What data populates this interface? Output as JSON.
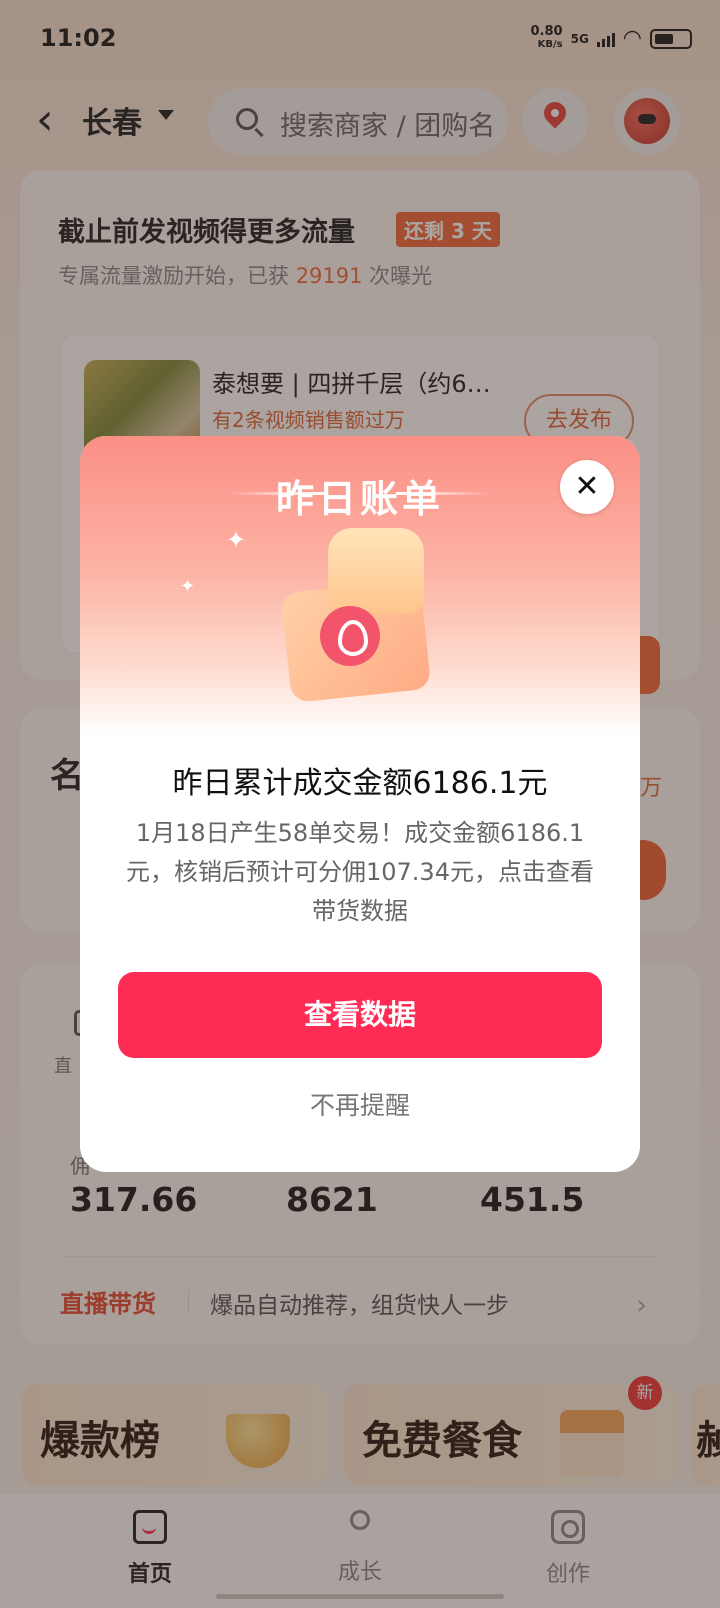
{
  "status_bar": {
    "time": "11:02",
    "net_speed": "0.80",
    "net_unit": "KB/s",
    "signal": "5G"
  },
  "header": {
    "back_icon": "chevron-left-icon",
    "city": "长春",
    "search_placeholder": "搜索商家 / 团购名"
  },
  "incentive_card": {
    "title": "截止前发视频得更多流量",
    "badge": "还剩 3 天",
    "sub_prefix": "专属流量激励开始，已获 ",
    "exposure_count": "29191",
    "sub_suffix": " 次曝光",
    "product": {
      "name": "泰想要 | 四拼千层（约6…",
      "note": "有2条视频销售额过万",
      "action": "去发布"
    }
  },
  "stats_card": {
    "left_partial": "直",
    "values": [
      {
        "label": "佣",
        "value": "317.66"
      },
      {
        "label": "",
        "value": "8621"
      },
      {
        "label": "",
        "value": "451.5"
      }
    ],
    "live": {
      "tag": "直播带货",
      "text": "爆品自动推荐，组货快人一步"
    }
  },
  "middle_card": {
    "left_partial": "名",
    "right_partial": "万"
  },
  "promo_tiles": [
    {
      "label": "爆款榜"
    },
    {
      "label": "免费餐食",
      "badge": "新"
    },
    {
      "label": "赪"
    }
  ],
  "tab_bar": [
    {
      "label": "首页",
      "icon": "home-bag-icon",
      "active": true
    },
    {
      "label": "成长",
      "icon": "user-star-icon",
      "active": false
    },
    {
      "label": "创作",
      "icon": "camera-icon",
      "active": false
    }
  ],
  "modal": {
    "title": "昨日账单",
    "headline": "昨日累计成交金额6186.1元",
    "description": "1月18日产生58单交易！成交金额6186.1元，核销后预计可分佣107.34元，点击查看带货数据",
    "primary_button": "查看数据",
    "dismiss": "不再提醒",
    "close_icon": "close-icon",
    "colors": {
      "button": "#fe2c55",
      "header_gradient_top": "#fb8f86"
    }
  }
}
